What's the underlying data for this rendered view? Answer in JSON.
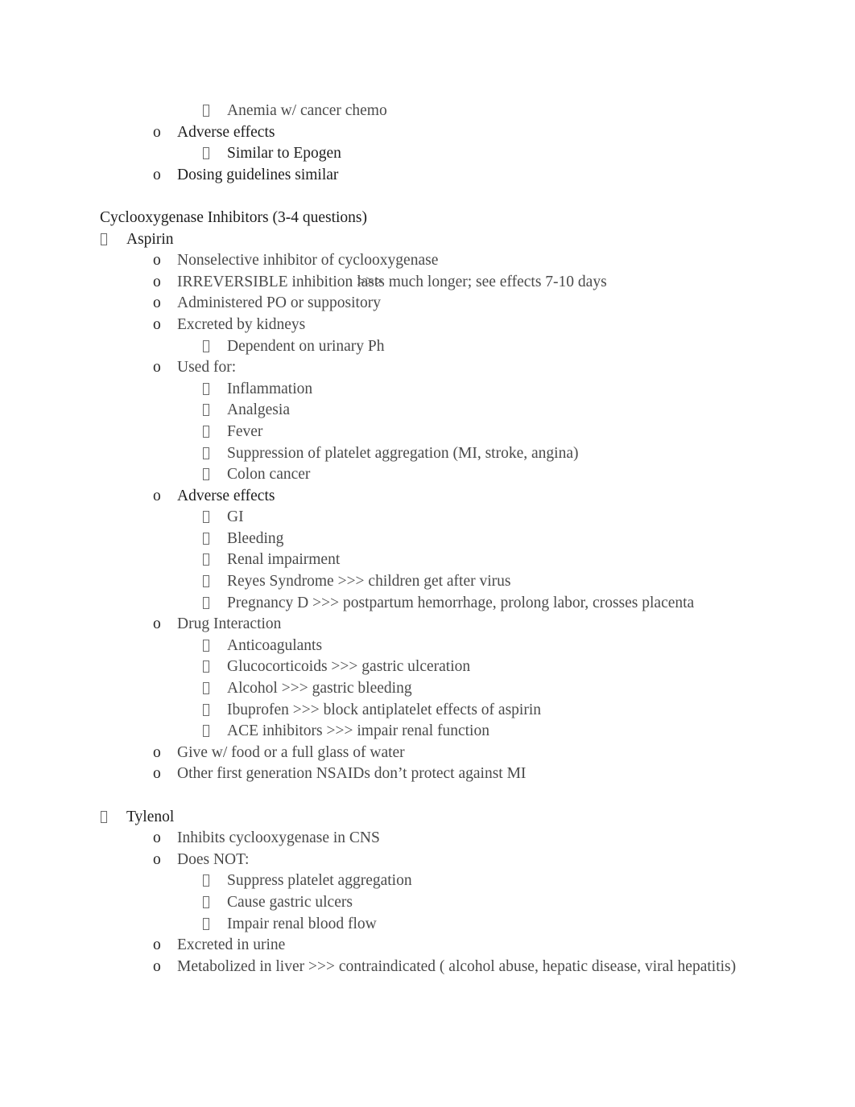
{
  "document": {
    "bullet_glyph": "missing-glyph-box",
    "level2_marker": "o",
    "colors": {
      "body_text": "#4a4a4a",
      "heading_text": "#1d1d1d",
      "marker": "#232323",
      "page_background": "#ffffff"
    }
  },
  "top_block": {
    "items": [
      {
        "text": "Anemia w/ cancer chemo"
      },
      {
        "text": "Adverse effects"
      },
      {
        "text": "Similar to Epogen"
      },
      {
        "text": "Dosing guidelines similar"
      }
    ]
  },
  "section_heading": "Cyclooxygenase Inhibitors (3-4 questions)",
  "aspirin": {
    "title": "Aspirin",
    "b1": "Nonselective inhibitor of cyclooxygenase",
    "b2_pre": "IRREVERSIBLE inhibition ",
    "b2_arrows": ">>>",
    "b2_post": "lasts much longer; see effects 7-10 days",
    "b3": "Administered PO or suppository",
    "b4": "Excreted by kidneys",
    "b4_sub1": "Dependent on urinary Ph",
    "b5": "Used for:",
    "used_for": [
      "Inflammation",
      "Analgesia",
      "Fever",
      "Suppression of platelet aggregation (MI, stroke, angina)",
      "Colon cancer"
    ],
    "b6": "Adverse effects",
    "adverse_effects": [
      "GI",
      "Bleeding",
      "Renal impairment",
      "Reyes Syndrome >>> children get after virus",
      "Pregnancy D >>> postpartum hemorrhage, prolong labor, crosses placenta"
    ],
    "b7": "Drug Interaction",
    "drug_interactions": [
      "Anticoagulants",
      "Glucocorticoids >>> gastric ulceration",
      "Alcohol >>> gastric bleeding",
      "Ibuprofen >>> block antiplatelet effects of aspirin",
      "ACE inhibitors >>> impair renal function"
    ],
    "b8": "Give w/ food or a full glass of water",
    "b9": "Other first generation NSAIDs don’t protect against MI"
  },
  "tylenol": {
    "title": "Tylenol",
    "b1": "Inhibits cyclooxygenase in CNS",
    "b2": "Does NOT:",
    "does_not": [
      "Suppress platelet aggregation",
      "Cause gastric ulcers",
      "Impair renal blood flow"
    ],
    "b3": "Excreted in urine",
    "b4": "Metabolized in liver >>> contraindicated ( alcohol abuse, hepatic disease, viral hepatitis)"
  }
}
